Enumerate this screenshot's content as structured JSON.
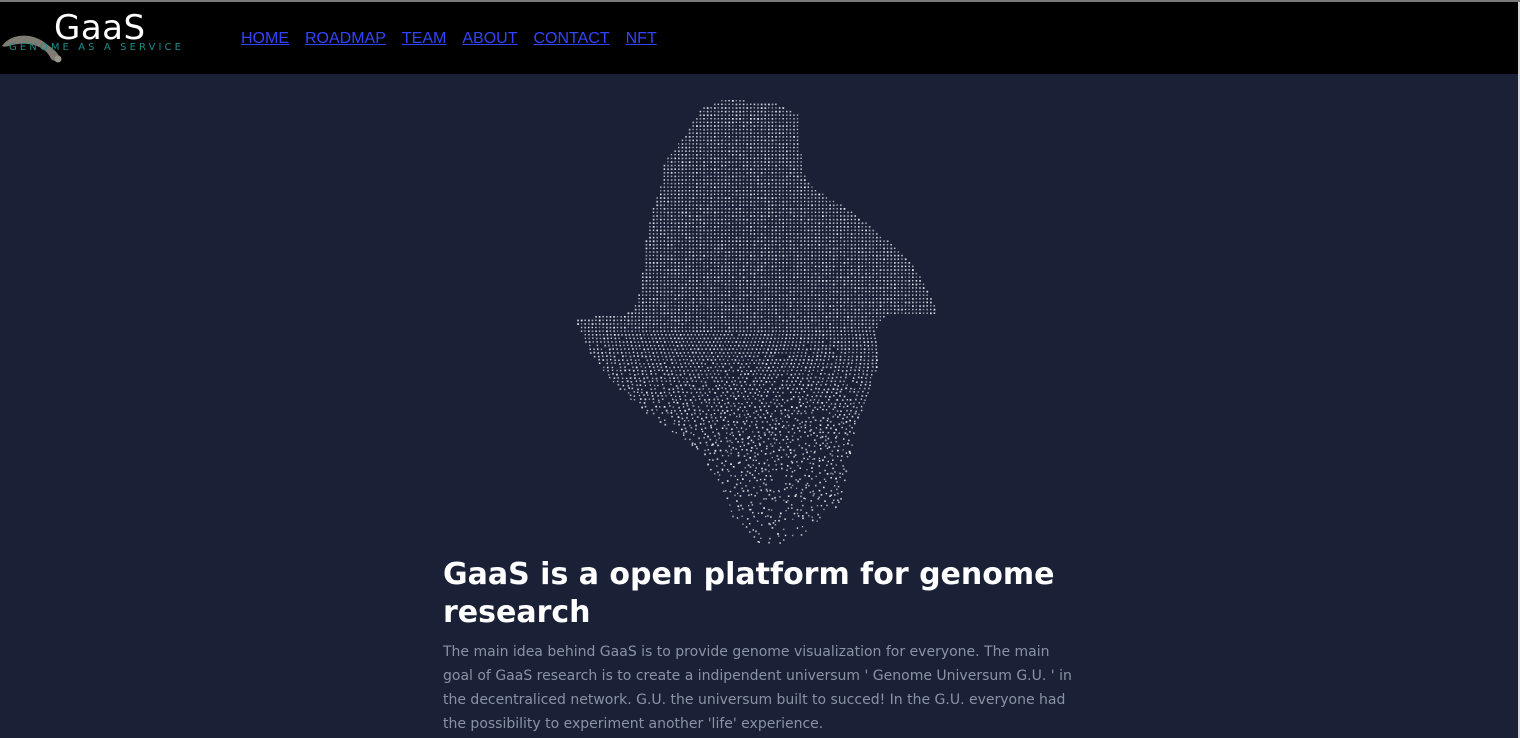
{
  "header": {
    "logo": {
      "title": "GaaS",
      "tagline": "GENOME AS A SERVICE",
      "tagline_color": "#1e8c8c"
    },
    "nav": [
      {
        "label": "HOME"
      },
      {
        "label": "ROADMAP"
      },
      {
        "label": "TEAM"
      },
      {
        "label": "ABOUT"
      },
      {
        "label": "CONTACT"
      },
      {
        "label": "NFT"
      }
    ],
    "link_color": "#3344ff"
  },
  "hero": {
    "headline": "GaaS is a open platform for genome research",
    "description": "The main idea behind GaaS is to provide genome visualization for everyone. The main goal of GaaS research is to create a indipendent universum ' Genome Universum G.U. ' in the decentraliced network. G.U. the universum built to succed! In the G.U. everyone had the possibility to experiment another 'life' experience."
  },
  "colors": {
    "background": "#1a2035",
    "navbar": "#000000",
    "text": "#ffffff",
    "muted_text": "#8a92a6"
  }
}
